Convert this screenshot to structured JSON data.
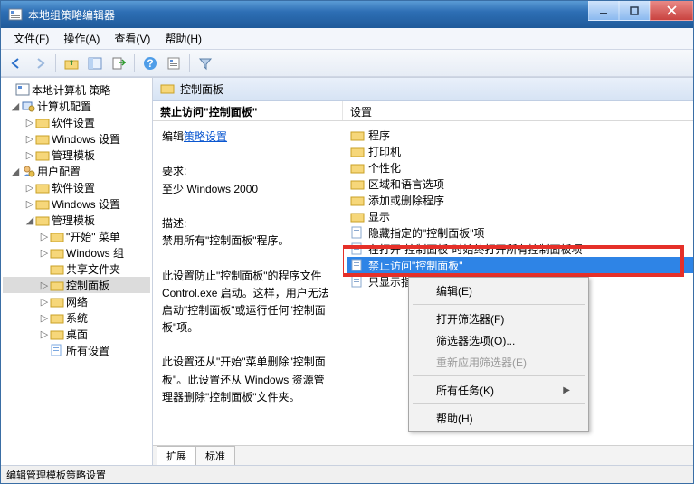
{
  "window": {
    "title": "本地组策略编辑器"
  },
  "menus": {
    "file": "文件(F)",
    "action": "操作(A)",
    "view": "查看(V)",
    "help": "帮助(H)"
  },
  "tree": {
    "root": "本地计算机 策略",
    "n1": "计算机配置",
    "n1a": "软件设置",
    "n1b": "Windows 设置",
    "n1c": "管理模板",
    "n2": "用户配置",
    "n2a": "软件设置",
    "n2b": "Windows 设置",
    "n2c": "管理模板",
    "n2c1": "\"开始\" 菜单",
    "n2c2": "Windows 组",
    "n2c3": "共享文件夹",
    "n2c4": "控制面板",
    "n2c5": "网络",
    "n2c6": "系统",
    "n2c7": "桌面",
    "n2c8": "所有设置"
  },
  "pathbar": "控制面板",
  "colhdr": {
    "left": "禁止访问\"控制面板\"",
    "right": "设置"
  },
  "detail": {
    "editPrefix": "编辑",
    "editLink": "策略设置",
    "reqLabel": "要求:",
    "reqValue": "至少 Windows 2000",
    "descLabel": "描述:",
    "p1": "禁用所有\"控制面板\"程序。",
    "p2": "此设置防止\"控制面板\"的程序文件 Control.exe 启动。这样，用户无法启动\"控制面板\"或运行任何\"控制面板\"项。",
    "p3": "此设置还从\"开始\"菜单删除\"控制面板\"。此设置还从 Windows 资源管理器删除\"控制面板\"文件夹。"
  },
  "settings": [
    "程序",
    "打印机",
    "个性化",
    "区域和语言选项",
    "添加或删除程序",
    "显示",
    "隐藏指定的\"控制面板\"项",
    "在打开\"控制面板\"时始终打开所有控制面板项",
    "禁止访问\"控制面板\"",
    "只显示指定的\"控制面板\"项"
  ],
  "ctx": {
    "edit": "编辑(E)",
    "filterOn": "打开筛选器(F)",
    "filterOpt": "筛选器选项(O)...",
    "filterReset": "重新应用筛选器(E)",
    "allTasks": "所有任务(K)",
    "help": "帮助(H)"
  },
  "tabs": {
    "ext": "扩展",
    "std": "标准"
  },
  "status": "编辑管理模板策略设置"
}
